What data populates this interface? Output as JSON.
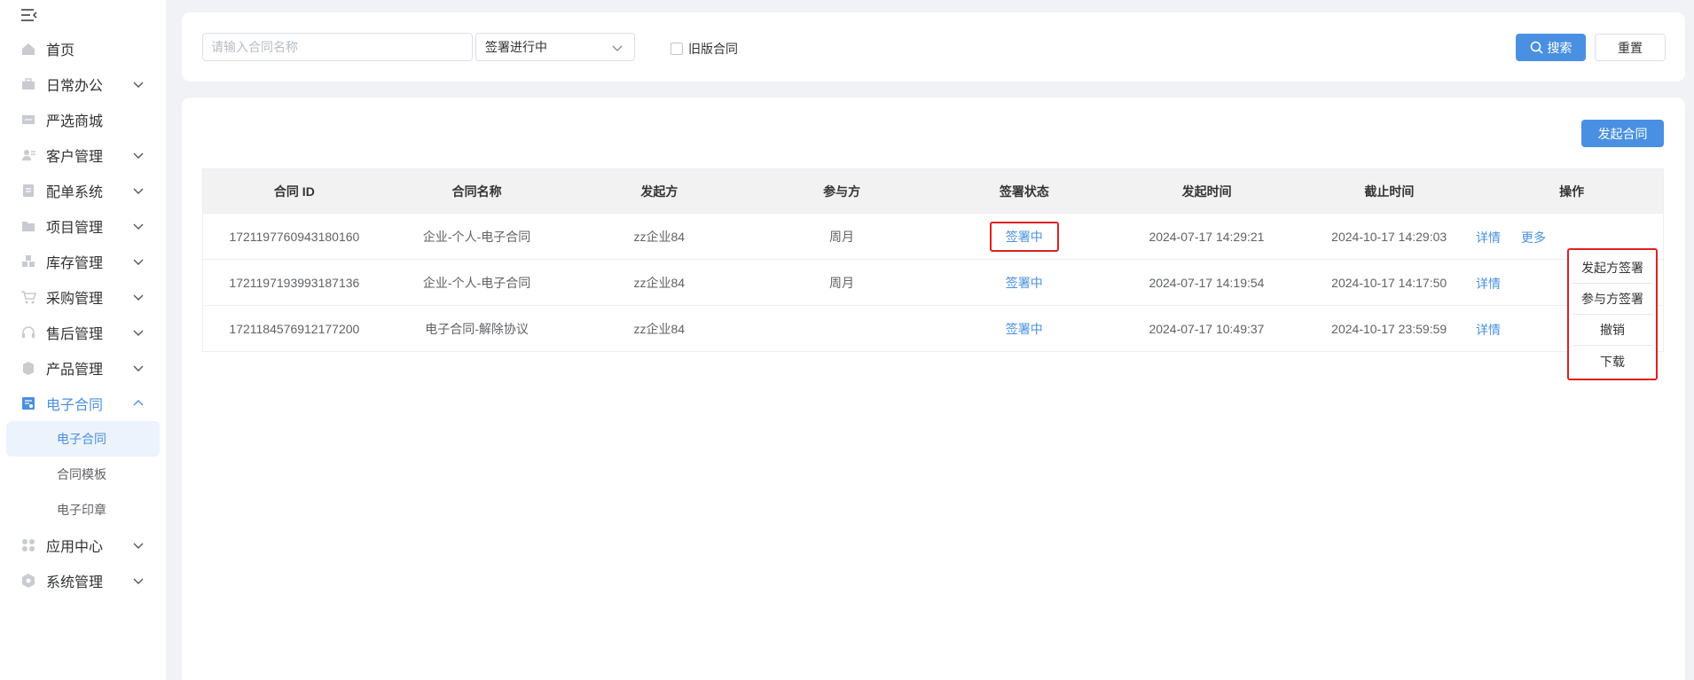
{
  "sidebar": {
    "items": [
      {
        "label": "首页",
        "icon": "home-icon"
      },
      {
        "label": "日常办公",
        "icon": "briefcase-icon"
      },
      {
        "label": "严选商城",
        "icon": "store-icon"
      },
      {
        "label": "客户管理",
        "icon": "customer-icon"
      },
      {
        "label": "配单系统",
        "icon": "document-icon"
      },
      {
        "label": "项目管理",
        "icon": "folder-icon"
      },
      {
        "label": "库存管理",
        "icon": "inventory-icon"
      },
      {
        "label": "采购管理",
        "icon": "cart-icon"
      },
      {
        "label": "售后管理",
        "icon": "headset-icon"
      },
      {
        "label": "产品管理",
        "icon": "box-icon"
      },
      {
        "label": "电子合同",
        "icon": "contract-icon"
      },
      {
        "label": "应用中心",
        "icon": "apps-icon"
      },
      {
        "label": "系统管理",
        "icon": "settings-icon"
      }
    ],
    "subitems": [
      {
        "label": "电子合同"
      },
      {
        "label": "合同模板"
      },
      {
        "label": "电子印章"
      }
    ]
  },
  "search": {
    "placeholder": "请输入合同名称",
    "status_value": "签署进行中",
    "old_contract_label": "旧版合同",
    "search_label": "搜索",
    "reset_label": "重置"
  },
  "main": {
    "launch_label": "发起合同"
  },
  "table": {
    "headers": [
      "合同 ID",
      "合同名称",
      "发起方",
      "参与方",
      "签署状态",
      "发起时间",
      "截止时间",
      "操作"
    ],
    "rows": [
      {
        "id": "1721197760943180160",
        "name": "企业-个人-电子合同",
        "initiator": "zz企业84",
        "participant": "周月",
        "status": "签署中",
        "start": "2024-07-17 14:29:21",
        "end": "2024-10-17 14:29:03",
        "detail": "详情",
        "more": "更多"
      },
      {
        "id": "1721197193993187136",
        "name": "企业-个人-电子合同",
        "initiator": "zz企业84",
        "participant": "周月",
        "status": "签署中",
        "start": "2024-07-17 14:19:54",
        "end": "2024-10-17 14:17:50",
        "detail": "详情",
        "more": ""
      },
      {
        "id": "1721184576912177200",
        "name": "电子合同-解除协议",
        "initiator": "zz企业84",
        "participant": "",
        "status": "签署中",
        "start": "2024-07-17 10:49:37",
        "end": "2024-10-17 23:59:59",
        "detail": "详情",
        "more": ""
      }
    ]
  },
  "dropdown": {
    "items": [
      "发起方签署",
      "参与方签署",
      "撤销",
      "下载"
    ]
  },
  "colors": {
    "accent": "#4a90e2",
    "highlight": "#e02020"
  }
}
